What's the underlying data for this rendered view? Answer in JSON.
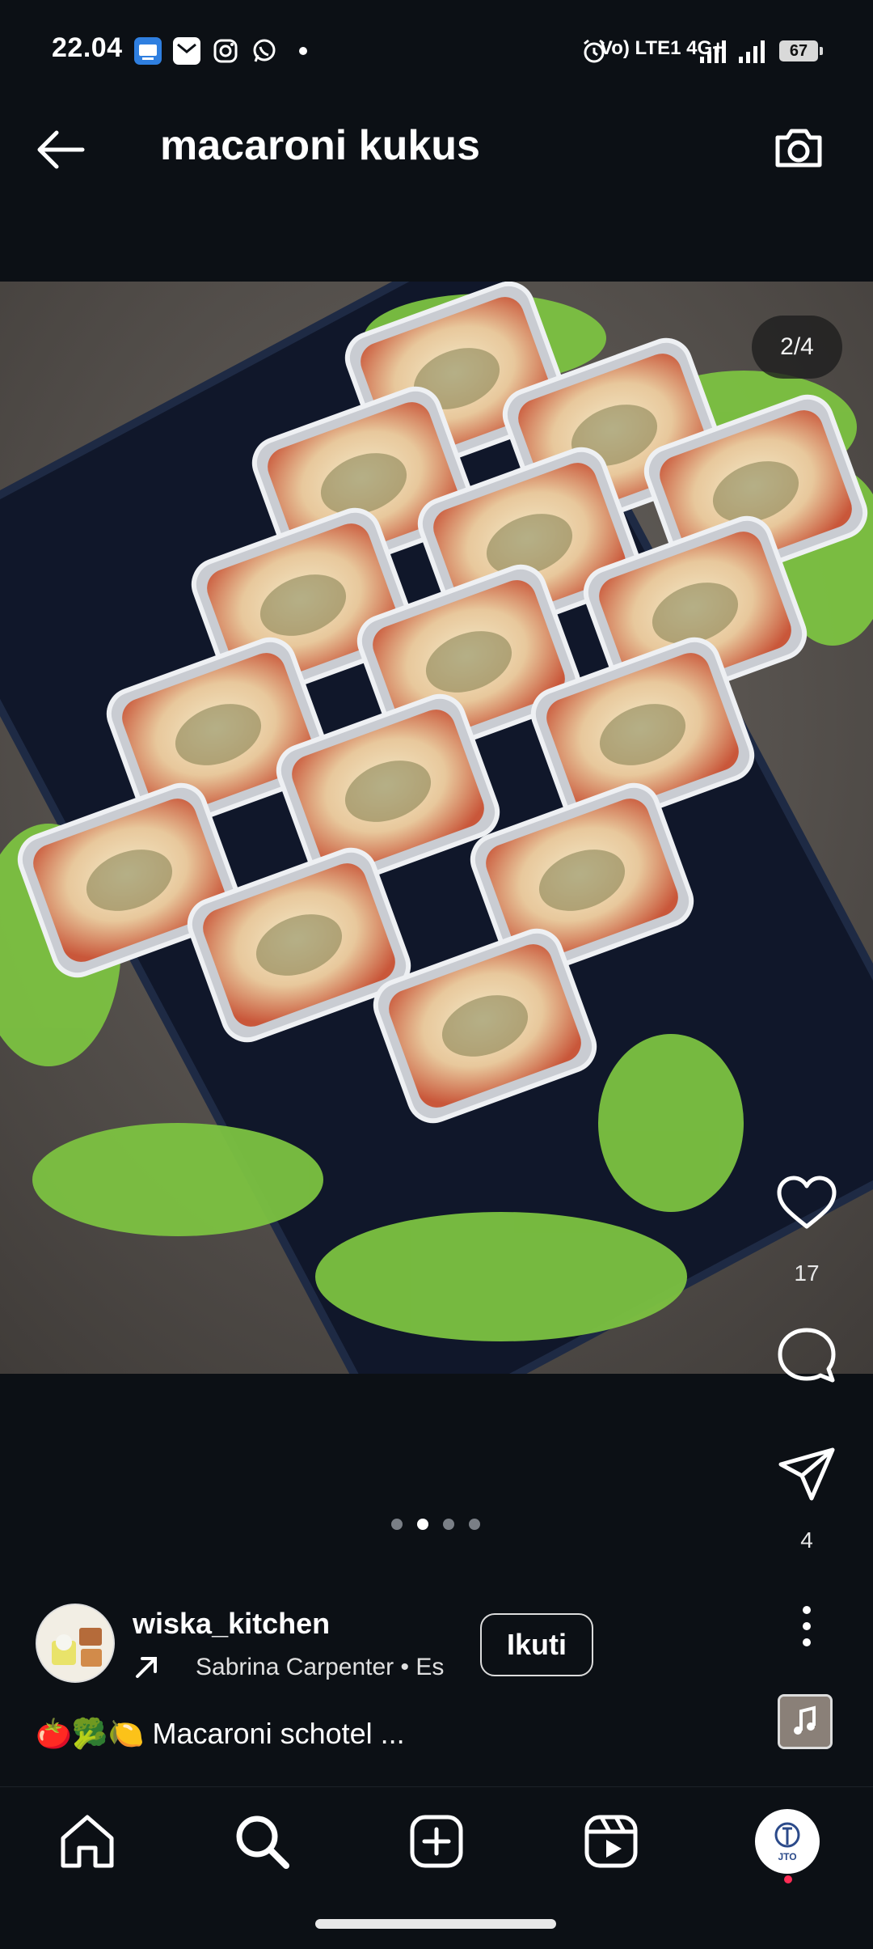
{
  "status_bar": {
    "time": "22.04",
    "network": "Vo) LTE1 4G+",
    "battery": "67"
  },
  "header": {
    "title": "macaroni kukus"
  },
  "post": {
    "slide_counter": "2/4",
    "total_slides": 4,
    "current_slide": 2,
    "likes": "17",
    "shares": "4",
    "author": {
      "username": "wiska_kitchen",
      "music": "Sabrina Carpenter • Es",
      "follow_label": "Ikuti"
    },
    "caption_emojis": "🍅🥦🍋",
    "caption": "Macaroni schotel ..."
  },
  "nav": {
    "profile_label": "JTO"
  },
  "icons": [
    "back-arrow-icon",
    "camera-icon",
    "heart-icon",
    "comment-icon",
    "share-icon",
    "more-icon",
    "home-icon",
    "search-icon",
    "create-icon",
    "reels-icon"
  ]
}
